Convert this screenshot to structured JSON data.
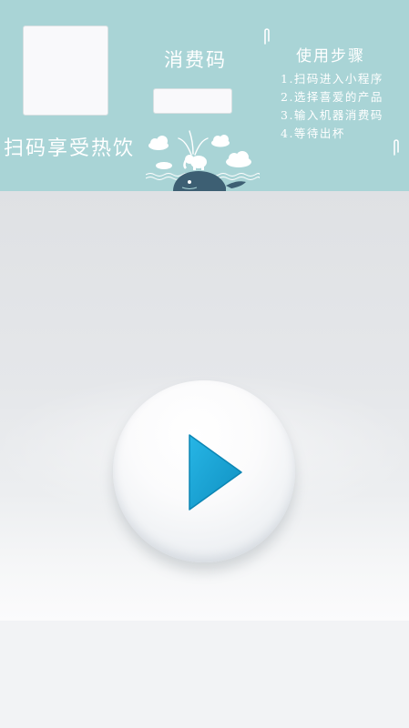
{
  "banner": {
    "slogan": "扫码享受热饮",
    "code_title": "消费码",
    "code_input_value": "",
    "steps_title": "使用步骤",
    "steps": [
      "1.扫码进入小程序",
      "2.选择喜爱的产品",
      "3.输入机器消费码",
      "4.等待出杯"
    ],
    "colors": {
      "background": "#a9d4d6",
      "text": "#ffffff",
      "whale": "#3d5f73"
    }
  },
  "video": {
    "play_icon": "play-icon",
    "colors": {
      "play": "#1aa6d6",
      "button": "#f7f8f9"
    }
  }
}
